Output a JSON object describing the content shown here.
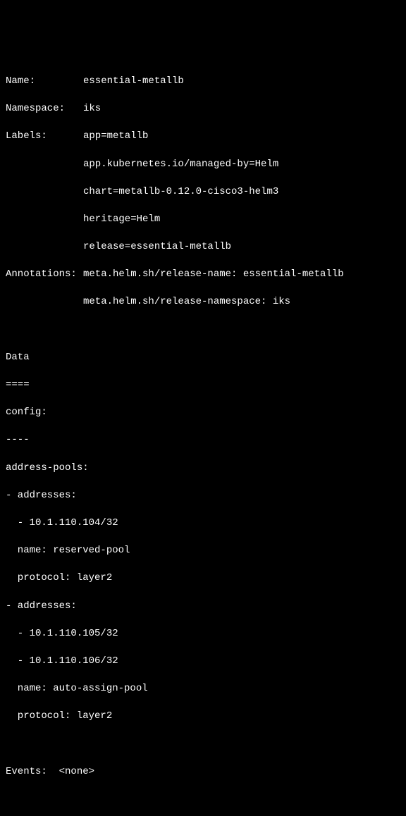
{
  "header": {
    "name_label": "Name:",
    "name_value": "essential-metallb",
    "namespace_label": "Namespace:",
    "namespace_value": "iks",
    "labels_label": "Labels:",
    "labels": [
      "app=metallb",
      "app.kubernetes.io/managed-by=Helm",
      "chart=metallb-0.12.0-cisco3-helm3",
      "heritage=Helm",
      "release=essential-metallb"
    ],
    "annotations_label": "Annotations:",
    "annotations": [
      "meta.helm.sh/release-name: essential-metallb",
      "meta.helm.sh/release-namespace: iks"
    ]
  },
  "data_section": {
    "title": "Data",
    "divider": "====",
    "config_key": "config:",
    "config_divider": "----",
    "address_pools_key": "address-pools:",
    "pools": [
      {
        "addresses_key": "- addresses:",
        "addresses": [
          "  - 10.1.110.104/32"
        ],
        "name_line": "  name: reserved-pool",
        "protocol_line": "  protocol: layer2"
      },
      {
        "addresses_key": "- addresses:",
        "addresses": [
          "  - 10.1.110.105/32",
          "  - 10.1.110.106/32"
        ],
        "name_line": "  name: auto-assign-pool",
        "protocol_line": "  protocol: layer2"
      }
    ]
  },
  "events": {
    "label": "Events:",
    "value": "<none>"
  }
}
